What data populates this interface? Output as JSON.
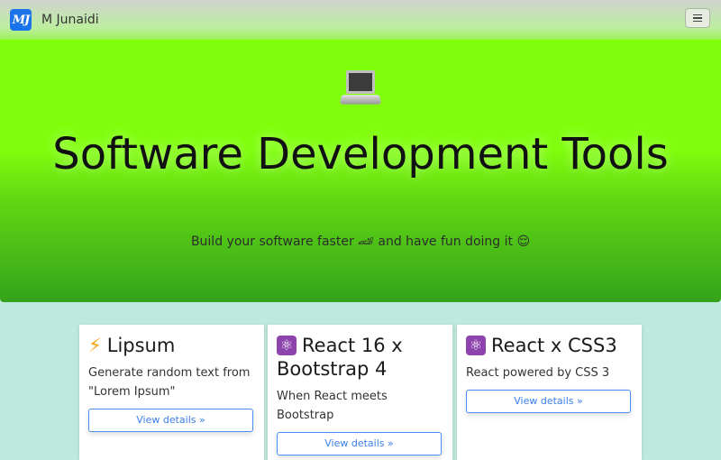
{
  "navbar": {
    "logo_text": "MJ",
    "brand_name": "M Junaidi"
  },
  "hero": {
    "icon": "laptop-icon",
    "title": "Software Development Tools",
    "subtitle": "Build your software faster 🏎 and have fun doing it 😌"
  },
  "cards": [
    {
      "icon": "lightning-icon",
      "icon_glyph": "⚡",
      "title": "Lipsum",
      "text": "Generate random text from \"Lorem Ipsum\"",
      "button_label": "View details »"
    },
    {
      "icon": "atom-icon",
      "icon_glyph": "⚛",
      "title": "React 16 x Bootstrap 4",
      "text": "When React meets Bootstrap",
      "button_label": "View details »"
    },
    {
      "icon": "atom-icon",
      "icon_glyph": "⚛",
      "title": "React x CSS3",
      "text": "React powered by CSS 3",
      "button_label": "View details »"
    }
  ],
  "colors": {
    "hero_top": "#7ffe0c",
    "hero_bottom": "#34a31b",
    "page_bg": "#bfe8de",
    "link_blue": "#3a7ee8"
  }
}
